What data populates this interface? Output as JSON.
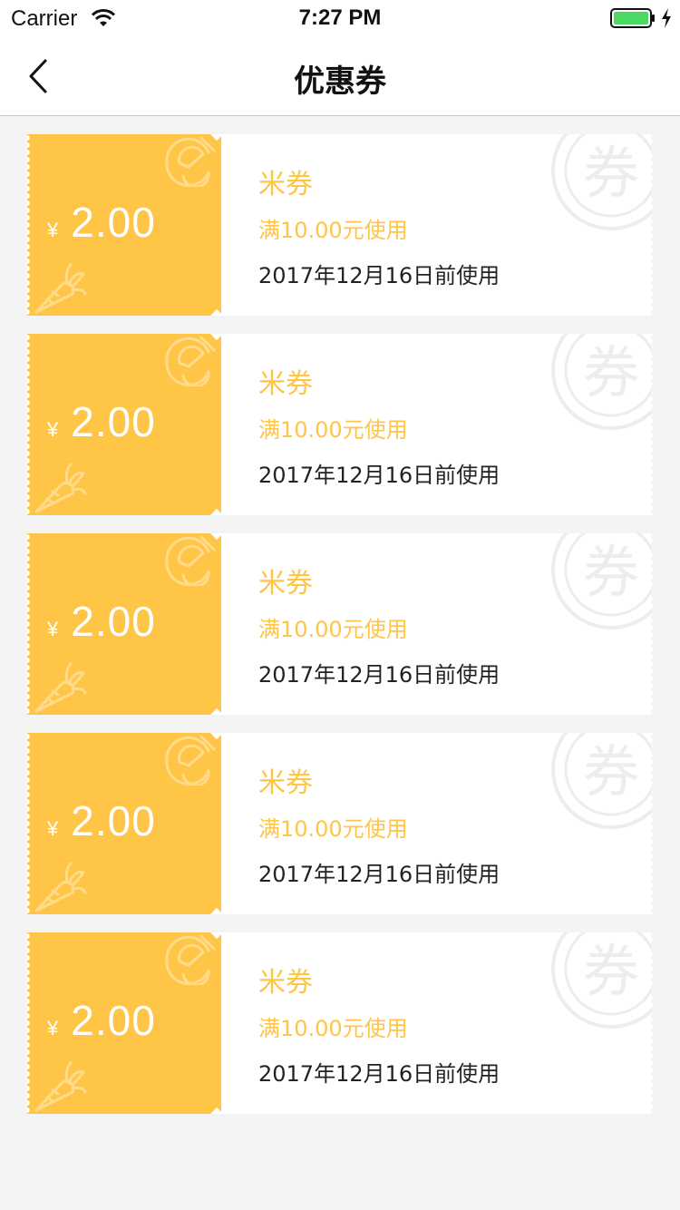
{
  "status_bar": {
    "carrier": "Carrier",
    "time": "7:27 PM",
    "battery_color": "#4cd964"
  },
  "nav": {
    "title": "优惠券",
    "back_icon": "chevron-left-icon"
  },
  "colors": {
    "accent": "#ffc547",
    "background": "#f4f4f4",
    "card": "#ffffff"
  },
  "coupons": [
    {
      "currency": "¥",
      "amount": "2.00",
      "name": "米券",
      "condition": "满10.00元使用",
      "expiry": "2017年12月16日前使用",
      "stamp_text": "券"
    },
    {
      "currency": "¥",
      "amount": "2.00",
      "name": "米券",
      "condition": "满10.00元使用",
      "expiry": "2017年12月16日前使用",
      "stamp_text": "券"
    },
    {
      "currency": "¥",
      "amount": "2.00",
      "name": "米券",
      "condition": "满10.00元使用",
      "expiry": "2017年12月16日前使用",
      "stamp_text": "券"
    },
    {
      "currency": "¥",
      "amount": "2.00",
      "name": "米券",
      "condition": "满10.00元使用",
      "expiry": "2017年12月16日前使用",
      "stamp_text": "券"
    },
    {
      "currency": "¥",
      "amount": "2.00",
      "name": "米券",
      "condition": "满10.00元使用",
      "expiry": "2017年12月16日前使用",
      "stamp_text": "券"
    }
  ]
}
